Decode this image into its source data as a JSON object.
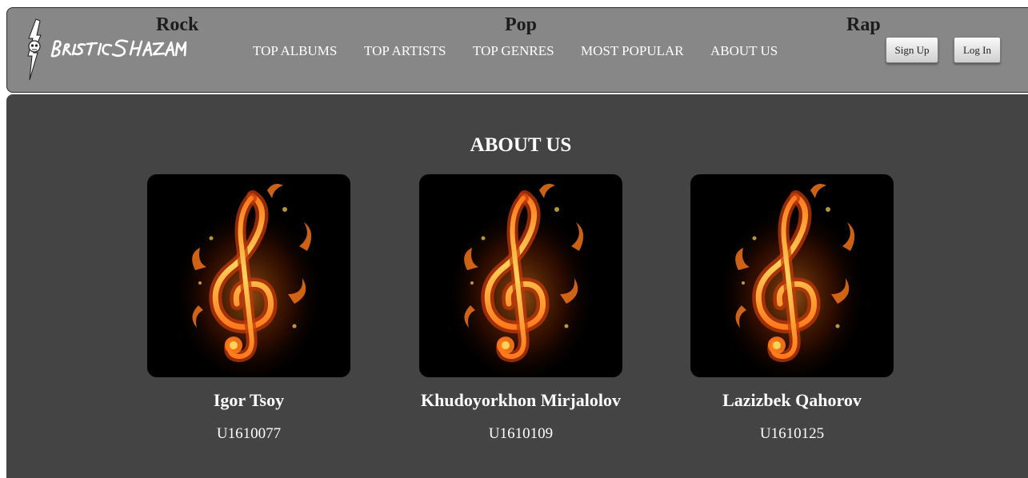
{
  "header": {
    "logo_alt": "BristicShazam",
    "genres": [
      "Rock",
      "Pop",
      "Rap"
    ],
    "nav": [
      "TOP ALBUMS",
      "TOP ARTISTS",
      "TOP GENRES",
      "MOST POPULAR",
      "ABOUT US"
    ],
    "signup_label": "Sign Up",
    "login_label": "Log In"
  },
  "main": {
    "title": "ABOUT US",
    "members": [
      {
        "name": "Igor Tsoy",
        "id": "U1610077",
        "photo_icon": "flaming-treble-clef-icon"
      },
      {
        "name": "Khudoyorkhon Mirjalolov",
        "id": "U1610109",
        "photo_icon": "flaming-treble-clef-icon"
      },
      {
        "name": "Lazizbek Qahorov",
        "id": "U1610125",
        "photo_icon": "flaming-treble-clef-icon"
      }
    ]
  },
  "colors": {
    "header_bg": "#878787",
    "main_bg": "#444444",
    "text_light": "#ffffff",
    "genre_text": "#1c1c1c",
    "flame_orange": "#ff7a1a",
    "flame_yellow": "#ffd35a"
  }
}
